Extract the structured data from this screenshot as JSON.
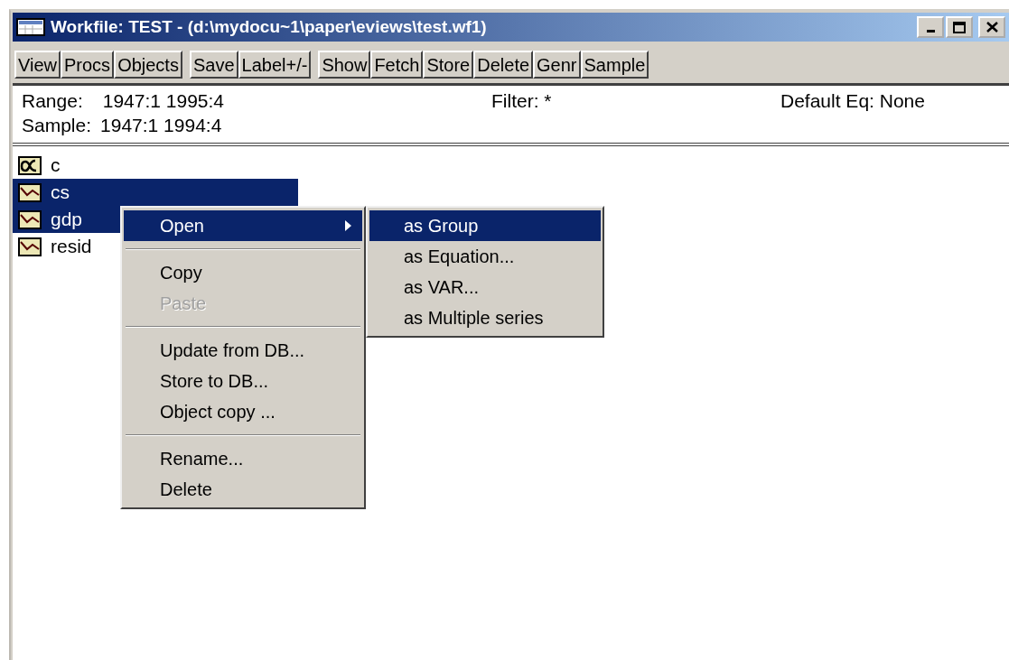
{
  "window": {
    "title": "Workfile: TEST - (d:\\mydocu~1\\paper\\eviews\\test.wf1)"
  },
  "toolbar": [
    [
      "View",
      "Procs",
      "Objects"
    ],
    [
      "Save",
      "Label+/-"
    ],
    [
      "Show",
      "Fetch",
      "Store",
      "Delete",
      "Genr",
      "Sample"
    ]
  ],
  "info": {
    "range_label": "Range:",
    "range_value": "1947:1 1995:4",
    "sample_label": "Sample:",
    "sample_value": "1947:1 1994:4",
    "filter": "Filter: *",
    "default_eq": "Default Eq: None"
  },
  "objects": [
    {
      "name": "c",
      "kind": "coef",
      "selected": false
    },
    {
      "name": "cs",
      "kind": "series",
      "selected": true
    },
    {
      "name": "gdp",
      "kind": "series",
      "selected": true
    },
    {
      "name": "resid",
      "kind": "series",
      "selected": false
    }
  ],
  "context_menu": [
    {
      "kind": "item",
      "label": "Open",
      "selected": true,
      "disabled": false,
      "submenu": true
    },
    {
      "kind": "separator"
    },
    {
      "kind": "item",
      "label": "Copy",
      "selected": false,
      "disabled": false,
      "submenu": false
    },
    {
      "kind": "item",
      "label": "Paste",
      "selected": false,
      "disabled": true,
      "submenu": false
    },
    {
      "kind": "separator"
    },
    {
      "kind": "item",
      "label": "Update from DB...",
      "selected": false,
      "disabled": false,
      "submenu": false
    },
    {
      "kind": "item",
      "label": "Store to DB...",
      "selected": false,
      "disabled": false,
      "submenu": false
    },
    {
      "kind": "item",
      "label": "Object copy ...",
      "selected": false,
      "disabled": false,
      "submenu": false
    },
    {
      "kind": "separator"
    },
    {
      "kind": "item",
      "label": "Rename...",
      "selected": false,
      "disabled": false,
      "submenu": false
    },
    {
      "kind": "item",
      "label": "Delete",
      "selected": false,
      "disabled": false,
      "submenu": false
    }
  ],
  "submenu": [
    {
      "label": "as Group",
      "selected": true
    },
    {
      "label": "as Equation...",
      "selected": false
    },
    {
      "label": "as VAR...",
      "selected": false
    },
    {
      "label": "as Multiple series",
      "selected": false
    }
  ]
}
